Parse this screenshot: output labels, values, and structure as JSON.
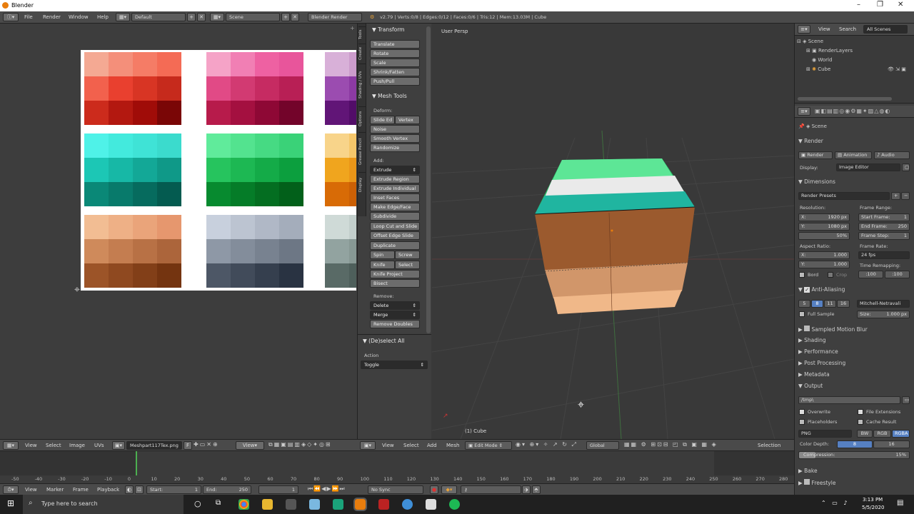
{
  "window": {
    "title": "Blender",
    "min": "–",
    "max": "❐",
    "close": "✕"
  },
  "topbar": {
    "menus": [
      "File",
      "Render",
      "Window",
      "Help"
    ],
    "layout": "Default",
    "scene": "Scene",
    "engine": "Blender Render",
    "info": "v2.79 | Verts:0/8 | Edges:0/12 | Faces:0/6 | Tris:12 | Mem:13.03M | Cube"
  },
  "tools": {
    "tabs": [
      "Tools",
      "Create",
      "Shading / UVs",
      "Options",
      "Grease Pencil",
      "Display"
    ],
    "transform_header": "Transform",
    "transform": [
      "Translate",
      "Rotate",
      "Scale",
      "Shrink/Fatten",
      "Push/Pull"
    ],
    "mesh_header": "Mesh Tools",
    "deform_label": "Deform:",
    "slide_edge": "Slide Ed",
    "vertex": "Vertex",
    "deform": [
      "Noise",
      "Smooth Vertex",
      "Randomize"
    ],
    "add_label": "Add:",
    "extrude": "Extrude",
    "add": [
      "Extrude Region",
      "Extrude Individual",
      "Inset Faces",
      "Make Edge/Face",
      "Subdivide",
      "Loop Cut and Slide",
      "Offset Edge Slide",
      "Duplicate"
    ],
    "spin": "Spin",
    "screw": "Screw",
    "knife": "Knife",
    "select": "Select",
    "add2": [
      "Knife Project",
      "Bisect"
    ],
    "remove_label": "Remove:",
    "delete": "Delete",
    "merge": "Merge",
    "remove_doubles": "Remove Doubles",
    "deselect_header": "(De)select All",
    "action_label": "Action",
    "action_value": "Toggle"
  },
  "viewport": {
    "label": "User Persp",
    "object_label": "(1) Cube"
  },
  "outliner": {
    "view": "View",
    "search": "Search",
    "filter": "All Scenes",
    "items": [
      "Scene",
      "RenderLayers",
      "World",
      "Cube"
    ]
  },
  "properties": {
    "context": "Scene",
    "render_header": "Render",
    "render_btns": [
      "Render",
      "Animation",
      "Audio"
    ],
    "display_label": "Display:",
    "display_value": "Image Editor",
    "dimensions_header": "Dimensions",
    "presets": "Render Presets",
    "resolution_label": "Resolution:",
    "res_x": "X:",
    "res_x_val": "1920 px",
    "res_y": "Y:",
    "res_y_val": "1080 px",
    "res_pct": "50%",
    "frame_range_label": "Frame Range:",
    "start_frame": "Start Frame:",
    "start_val": "1",
    "end_frame": "End Frame:",
    "end_val": "250",
    "frame_step": "Frame Step:",
    "step_val": "1",
    "aspect_label": "Aspect Ratio:",
    "ax": "X:",
    "ax_val": "1.000",
    "ay": "Y:",
    "ay_val": "1.000",
    "frame_rate_label": "Frame Rate:",
    "fps": "24 fps",
    "time_remap_label": "Time Remapping:",
    "remap_old": ":100",
    "remap_new": ":100",
    "border": "Bord",
    "crop": "Crop",
    "aa_header": "Anti-Aliasing",
    "aa_samples": [
      "5",
      "8",
      "11",
      "16"
    ],
    "aa_filter": "Mitchell-Netravali",
    "full_sample": "Full Sample",
    "size_label": "Size:",
    "size_val": "1.000 px",
    "sections": [
      "Sampled Motion Blur",
      "Shading",
      "Performance",
      "Post Processing",
      "Metadata"
    ],
    "output_header": "Output",
    "output_path": "/tmp\\",
    "overwrite": "Overwrite",
    "file_ext": "File Extensions",
    "placeholders": "Placeholders",
    "cache_result": "Cache Result",
    "format": "PNG",
    "bw": "BW",
    "rgb": "RGB",
    "rgba": "RGBA",
    "color_depth_label": "Color Depth:",
    "depth_8": "8",
    "depth_16": "16",
    "compression": "Compression:",
    "compression_val": "15%",
    "bake": "Bake",
    "freestyle": "Freestyle"
  },
  "uv_header": {
    "menus": [
      "View",
      "Select",
      "Image",
      "UVs"
    ],
    "image": "Meshpart117Tex.png",
    "F": "F",
    "view": "View"
  },
  "view3d_header": {
    "menus": [
      "View",
      "Select",
      "Add",
      "Mesh"
    ],
    "mode": "Edit Mode",
    "orientation": "Global",
    "selection": "Selection"
  },
  "timeline": {
    "ticks": [
      "-50",
      "-40",
      "-30",
      "-20",
      "-10",
      "0",
      "10",
      "20",
      "30",
      "40",
      "50",
      "60",
      "70",
      "80",
      "90",
      "100",
      "110",
      "120",
      "130",
      "140",
      "150",
      "160",
      "170",
      "180",
      "190",
      "200",
      "210",
      "220",
      "230",
      "240",
      "250",
      "260",
      "270",
      "280"
    ],
    "menus": [
      "View",
      "Marker",
      "Frame",
      "Playback"
    ],
    "start_label": "Start:",
    "start": "1",
    "end_label": "End:",
    "end": "250",
    "current": "1",
    "sync": "No Sync"
  },
  "taskbar": {
    "search": "Type here to search",
    "time": "3:13 PM",
    "date": "5/5/2020"
  },
  "colors": {
    "accent": "#5680c2",
    "selected": "#2b2b2b",
    "button": "#6c6c6c",
    "timeline_cursor": "#4caf50"
  }
}
